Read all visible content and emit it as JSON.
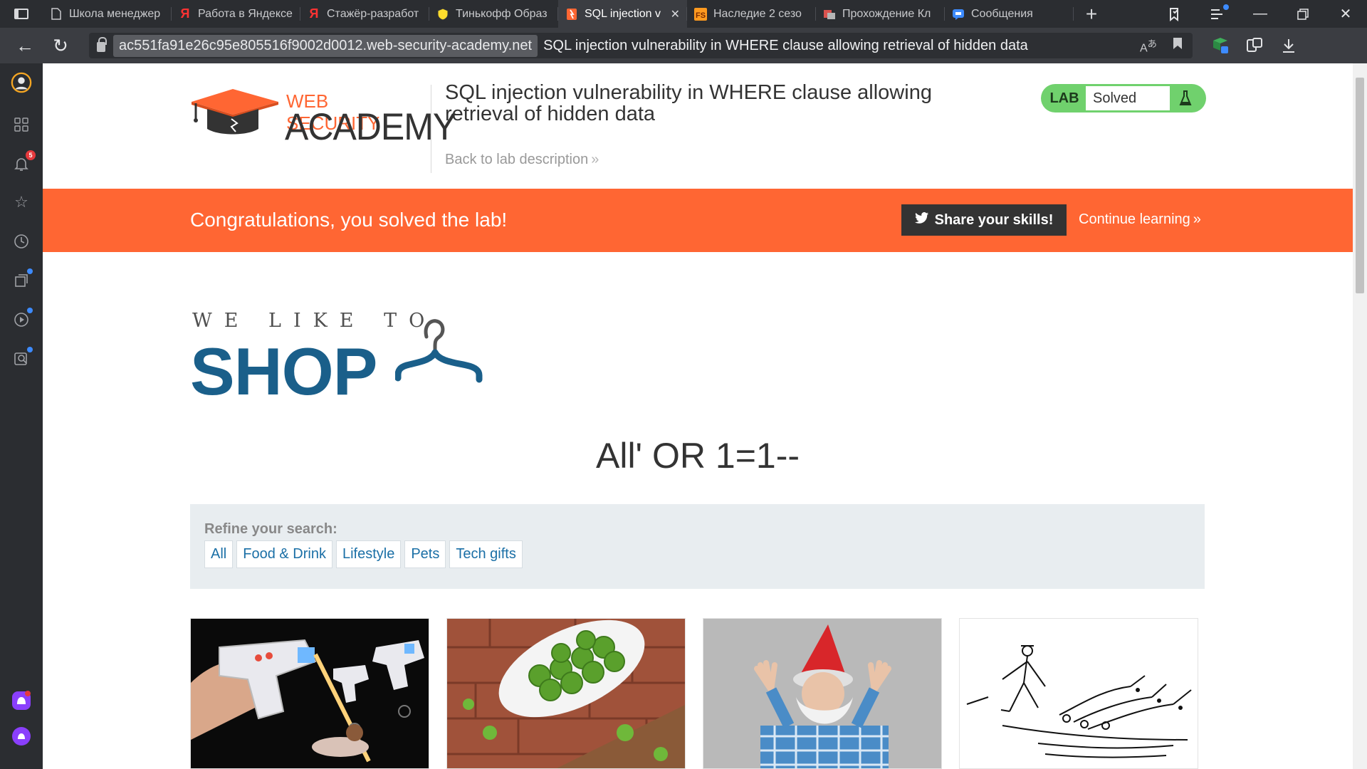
{
  "browser": {
    "tabs": [
      {
        "title": "Школа менеджер",
        "favicon": "page-icon",
        "active": false
      },
      {
        "title": "Работа в Яндексе",
        "favicon": "yandex-icon",
        "active": false
      },
      {
        "title": "Стажёр-разработ",
        "favicon": "yandex-icon",
        "active": false
      },
      {
        "title": "Тинькофф Образ",
        "favicon": "tinkoff-icon",
        "active": false
      },
      {
        "title": "SQL injection v",
        "favicon": "portswigger-icon",
        "active": true
      },
      {
        "title": "Наследие 2 сезо",
        "favicon": "fs-icon",
        "active": false
      },
      {
        "title": "Прохождение Кл",
        "favicon": "game-icon",
        "active": false
      },
      {
        "title": "Сообщения",
        "favicon": "messages-icon",
        "active": false
      }
    ],
    "new_tab": "+",
    "url_domain": "ac551fa91e26c95e805516f9002d0012.web-security-academy.net",
    "page_title": "SQL injection vulnerability in WHERE clause allowing retrieval of hidden data",
    "sidebar_badge": "5"
  },
  "academy": {
    "logo_top": "WEB SECURITY",
    "logo_bottom": "ACADEMY",
    "lab_title": "SQL injection vulnerability in WHERE clause allowing retrieval of hidden data",
    "back_link": "Back to lab description",
    "lab_label": "LAB",
    "lab_status": "Solved"
  },
  "banner": {
    "message": "Congratulations, you solved the lab!",
    "share_button": "Share your skills!",
    "continue_link": "Continue learning"
  },
  "shop": {
    "logo_top": "WE LIKE TO",
    "logo_main": "SHOP",
    "search_heading": "All' OR 1=1--",
    "refine_label": "Refine your search:",
    "filters": [
      "All",
      "Food & Drink",
      "Lifestyle",
      "Pets",
      "Tech gifts"
    ]
  },
  "colors": {
    "accent_orange": "#ff6633",
    "lab_green": "#70d16d",
    "shop_blue": "#1a5f8a",
    "link_blue": "#1a6fa6"
  }
}
